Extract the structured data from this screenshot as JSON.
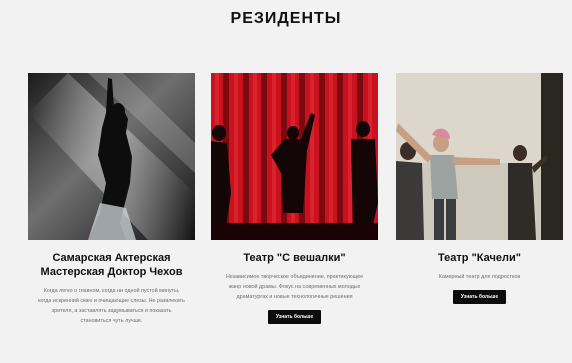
{
  "page": {
    "title": "РЕЗИДЕНТЫ"
  },
  "residents": [
    {
      "name": "Самарская Актерская Мастерская Доктор Чехов",
      "description": "Когда легко о главном, когда ни одной пустой минуты, когда искренний смех и очищающие слезы. Не развлекать зрителя, а заставлять задумываться и показать становиться чуть лучше.",
      "button_label": "",
      "image_icon": "dancer-spotlight-photo"
    },
    {
      "name": "Театр \"С вешалки\"",
      "description": "Независимое творческое объединение, практикующее жанр новой драмы. Фокус на современных молодых драматургах и новые технологичные решения",
      "button_label": "Узнать больше",
      "image_icon": "red-curtain-stage-photo"
    },
    {
      "name": "Театр \"Качели\"",
      "description": "Камерный театр для подростков",
      "button_label": "Узнать больше",
      "image_icon": "actors-on-stage-photo"
    }
  ],
  "colors": {
    "background": "#f2f2f2",
    "button": "#0c0c0c",
    "curtain": "#c8121f"
  }
}
